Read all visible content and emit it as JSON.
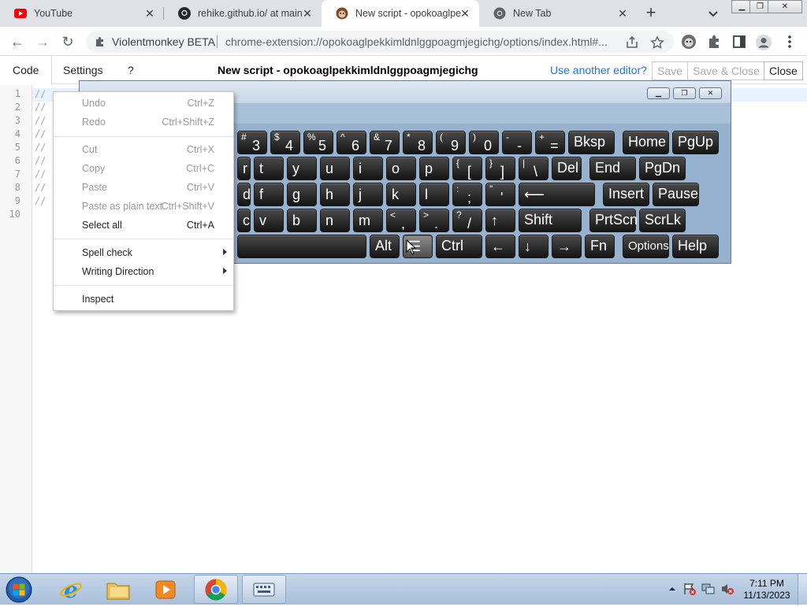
{
  "browser": {
    "tabs": [
      {
        "title": "YouTube",
        "favicon": "youtube-icon",
        "active": false
      },
      {
        "title": "rehike.github.io/ at main",
        "favicon": "github-icon",
        "active": false
      },
      {
        "title": "New script - opokoaglpe",
        "favicon": "violentmonkey-icon",
        "active": true
      },
      {
        "title": "New Tab",
        "favicon": "chrome-icon",
        "active": false
      }
    ],
    "new_tab_icon": "plus-icon",
    "address": {
      "site_label": "Violentmonkey BETA",
      "url": "chrome-extension://opokoaglpekkimldnlggpoagmjegichg/options/index.html#..."
    }
  },
  "vm": {
    "tabs": {
      "code": "Code",
      "settings": "Settings",
      "help": "?"
    },
    "script_title": "New script - opokoaglpekkimldnlggpoagmjegichg",
    "another_editor": "Use another editor?",
    "buttons": {
      "save": "Save",
      "save_close": "Save & Close",
      "close": "Close"
    }
  },
  "editor": {
    "line_numbers": [
      "1",
      "2",
      "3",
      "4",
      "5",
      "6",
      "7",
      "8",
      "9",
      "10"
    ],
    "lines": [
      "//",
      "//",
      "//",
      "//",
      "//",
      "//",
      "//",
      "//",
      "//",
      ""
    ]
  },
  "context_menu": {
    "groups": [
      [
        {
          "label": "Undo",
          "shortcut": "Ctrl+Z",
          "enabled": false
        },
        {
          "label": "Redo",
          "shortcut": "Ctrl+Shift+Z",
          "enabled": false
        }
      ],
      [
        {
          "label": "Cut",
          "shortcut": "Ctrl+X",
          "enabled": false
        },
        {
          "label": "Copy",
          "shortcut": "Ctrl+C",
          "enabled": false
        },
        {
          "label": "Paste",
          "shortcut": "Ctrl+V",
          "enabled": false
        },
        {
          "label": "Paste as plain text",
          "shortcut": "Ctrl+Shift+V",
          "enabled": false
        },
        {
          "label": "Select all",
          "shortcut": "Ctrl+A",
          "enabled": true
        }
      ],
      [
        {
          "label": "Spell check",
          "shortcut": "",
          "enabled": true,
          "submenu": true
        },
        {
          "label": "Writing Direction",
          "shortcut": "",
          "enabled": true,
          "submenu": true
        }
      ],
      [
        {
          "label": "Inspect",
          "shortcut": "",
          "enabled": true
        }
      ]
    ]
  },
  "keyboard": {
    "rows": [
      [
        {
          "main": "3",
          "shift": "#"
        },
        {
          "main": "4",
          "shift": "$"
        },
        {
          "main": "5",
          "shift": "%"
        },
        {
          "main": "6",
          "shift": "^"
        },
        {
          "main": "7",
          "shift": "&"
        },
        {
          "main": "8",
          "shift": "*"
        },
        {
          "main": "9",
          "shift": "("
        },
        {
          "main": "0",
          "shift": ")"
        },
        {
          "main": "-",
          "shift": "-"
        },
        {
          "main": "=",
          "shift": "+"
        },
        {
          "main": "Bksp",
          "shift": ""
        },
        {
          "main": "Home",
          "shift": ""
        },
        {
          "main": "PgUp",
          "shift": ""
        }
      ],
      [
        {
          "main": "r",
          "shift": ""
        },
        {
          "main": "t",
          "shift": ""
        },
        {
          "main": "y",
          "shift": ""
        },
        {
          "main": "u",
          "shift": ""
        },
        {
          "main": "i",
          "shift": ""
        },
        {
          "main": "o",
          "shift": ""
        },
        {
          "main": "p",
          "shift": ""
        },
        {
          "main": "[",
          "shift": "{"
        },
        {
          "main": "]",
          "shift": "}"
        },
        {
          "main": "\\",
          "shift": "|"
        },
        {
          "main": "Del",
          "shift": ""
        },
        {
          "main": "End",
          "shift": ""
        },
        {
          "main": "PgDn",
          "shift": ""
        }
      ],
      [
        {
          "main": "d",
          "shift": ""
        },
        {
          "main": "f",
          "shift": ""
        },
        {
          "main": "g",
          "shift": ""
        },
        {
          "main": "h",
          "shift": ""
        },
        {
          "main": "j",
          "shift": ""
        },
        {
          "main": "k",
          "shift": ""
        },
        {
          "main": "l",
          "shift": ""
        },
        {
          "main": ";",
          "shift": ":"
        },
        {
          "main": "'",
          "shift": "\""
        },
        {
          "main": "⟵",
          "shift": ""
        },
        {
          "main": "Insert",
          "shift": ""
        },
        {
          "main": "Pause",
          "shift": ""
        }
      ],
      [
        {
          "main": "c",
          "shift": ""
        },
        {
          "main": "v",
          "shift": ""
        },
        {
          "main": "b",
          "shift": ""
        },
        {
          "main": "n",
          "shift": ""
        },
        {
          "main": "m",
          "shift": ""
        },
        {
          "main": ",",
          "shift": "<"
        },
        {
          "main": ".",
          "shift": ">"
        },
        {
          "main": "/",
          "shift": "?"
        },
        {
          "main": "↑",
          "shift": ""
        },
        {
          "main": "Shift",
          "shift": ""
        },
        {
          "main": "PrtScn",
          "shift": ""
        },
        {
          "main": "ScrLk",
          "shift": ""
        }
      ],
      [
        {
          "main": "",
          "shift": ""
        },
        {
          "main": "Alt",
          "shift": ""
        },
        {
          "main": "☰",
          "shift": ""
        },
        {
          "main": "Ctrl",
          "shift": ""
        },
        {
          "main": "←",
          "shift": ""
        },
        {
          "main": "↓",
          "shift": ""
        },
        {
          "main": "→",
          "shift": ""
        },
        {
          "main": "Fn",
          "shift": ""
        },
        {
          "main": "Options",
          "shift": ""
        },
        {
          "main": "Help",
          "shift": ""
        }
      ]
    ]
  },
  "taskbar": {
    "apps": [
      "internet-explorer-icon",
      "file-explorer-icon",
      "media-player-icon",
      "chrome-icon",
      "on-screen-keyboard-icon"
    ],
    "clock": {
      "time": "7:11 PM",
      "date": "11/13/2023"
    }
  },
  "colors": {
    "accent": "#1a73e8",
    "tab_strip": "#dee1e6",
    "keyboard_bg": "#97b2cf"
  }
}
